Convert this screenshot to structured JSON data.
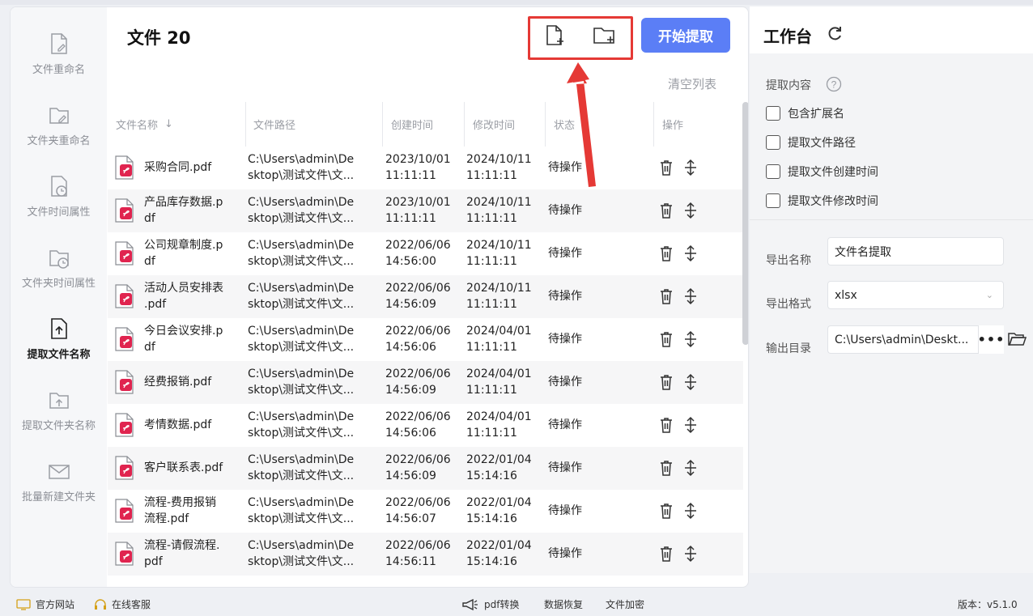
{
  "sidebar": {
    "items": [
      {
        "label": "文件重命名",
        "icon": "file-edit-icon"
      },
      {
        "label": "文件夹重命名",
        "icon": "folder-edit-icon"
      },
      {
        "label": "文件时间属性",
        "icon": "file-clock-icon"
      },
      {
        "label": "文件夹时间属性",
        "icon": "folder-clock-icon"
      },
      {
        "label": "提取文件名称",
        "icon": "file-upload-icon",
        "active": true
      },
      {
        "label": "提取文件夹名称",
        "icon": "folder-upload-icon"
      },
      {
        "label": "批量新建文件夹",
        "icon": "folder-new-icon"
      }
    ]
  },
  "header": {
    "files_title": "文件 20",
    "start_button": "开始提取",
    "clear_list": "清空列表"
  },
  "table": {
    "columns": [
      "文件名称",
      "文件路径",
      "创建时间",
      "修改时间",
      "状态",
      "操作"
    ],
    "rows": [
      {
        "name": [
          "采购合同.pdf"
        ],
        "path": [
          "C:\\Users\\admin\\De",
          "sktop\\测试文件\\文..."
        ],
        "created": [
          "2023/10/01",
          "11:11:11"
        ],
        "modified": [
          "2024/10/11",
          "11:11:11"
        ],
        "status": "待操作"
      },
      {
        "name": [
          "产品库存数据.p",
          "df"
        ],
        "path": [
          "C:\\Users\\admin\\De",
          "sktop\\测试文件\\文..."
        ],
        "created": [
          "2023/10/01",
          "11:11:11"
        ],
        "modified": [
          "2024/10/11",
          "11:11:11"
        ],
        "status": "待操作"
      },
      {
        "name": [
          "公司规章制度.p",
          "df"
        ],
        "path": [
          "C:\\Users\\admin\\De",
          "sktop\\测试文件\\文..."
        ],
        "created": [
          "2022/06/06",
          "14:56:00"
        ],
        "modified": [
          "2024/10/11",
          "11:11:11"
        ],
        "status": "待操作"
      },
      {
        "name": [
          "活动人员安排表",
          ".pdf"
        ],
        "path": [
          "C:\\Users\\admin\\De",
          "sktop\\测试文件\\文..."
        ],
        "created": [
          "2022/06/06",
          "14:56:09"
        ],
        "modified": [
          "2024/10/11",
          "11:11:11"
        ],
        "status": "待操作"
      },
      {
        "name": [
          "今日会议安排.p",
          "df"
        ],
        "path": [
          "C:\\Users\\admin\\De",
          "sktop\\测试文件\\文..."
        ],
        "created": [
          "2022/06/06",
          "14:56:06"
        ],
        "modified": [
          "2024/04/01",
          "11:11:11"
        ],
        "status": "待操作"
      },
      {
        "name": [
          "经费报销.pdf"
        ],
        "path": [
          "C:\\Users\\admin\\De",
          "sktop\\测试文件\\文..."
        ],
        "created": [
          "2022/06/06",
          "14:56:09"
        ],
        "modified": [
          "2024/04/01",
          "11:11:11"
        ],
        "status": "待操作"
      },
      {
        "name": [
          "考情数据.pdf"
        ],
        "path": [
          "C:\\Users\\admin\\De",
          "sktop\\测试文件\\文..."
        ],
        "created": [
          "2022/06/06",
          "14:56:06"
        ],
        "modified": [
          "2024/04/01",
          "11:11:11"
        ],
        "status": "待操作"
      },
      {
        "name": [
          "客户联系表.pdf"
        ],
        "path": [
          "C:\\Users\\admin\\De",
          "sktop\\测试文件\\文..."
        ],
        "created": [
          "2022/06/06",
          "14:56:09"
        ],
        "modified": [
          "2022/01/04",
          "15:14:16"
        ],
        "status": "待操作"
      },
      {
        "name": [
          "流程-费用报销",
          "流程.pdf"
        ],
        "path": [
          "C:\\Users\\admin\\De",
          "sktop\\测试文件\\文..."
        ],
        "created": [
          "2022/06/06",
          "14:56:07"
        ],
        "modified": [
          "2022/01/04",
          "15:14:16"
        ],
        "status": "待操作"
      },
      {
        "name": [
          "流程-请假流程.",
          "pdf"
        ],
        "path": [
          "C:\\Users\\admin\\De",
          "sktop\\测试文件\\文..."
        ],
        "created": [
          "2022/06/06",
          "14:56:11"
        ],
        "modified": [
          "2022/01/04",
          "15:14:16"
        ],
        "status": "待操作"
      }
    ]
  },
  "workbench": {
    "title": "工作台",
    "extract_label": "提取内容",
    "options": [
      "包含扩展名",
      "提取文件路径",
      "提取文件创建时间",
      "提取文件修改时间"
    ],
    "export_name_label": "导出名称",
    "export_name_value": "文件名提取",
    "export_format_label": "导出格式",
    "export_format_value": "xlsx",
    "output_dir_label": "输出目录",
    "output_dir_value": "C:\\Users\\admin\\Deskt..."
  },
  "footer": {
    "official_site": "官方网站",
    "online_service": "在线客服",
    "pdf_convert": "pdf转换",
    "data_recovery": "数据恢复",
    "file_encrypt": "文件加密",
    "version": "版本：v5.1.0"
  },
  "colors": {
    "accent": "#5b7ef6",
    "highlight": "#e53935",
    "pdf": "#e0244f"
  }
}
